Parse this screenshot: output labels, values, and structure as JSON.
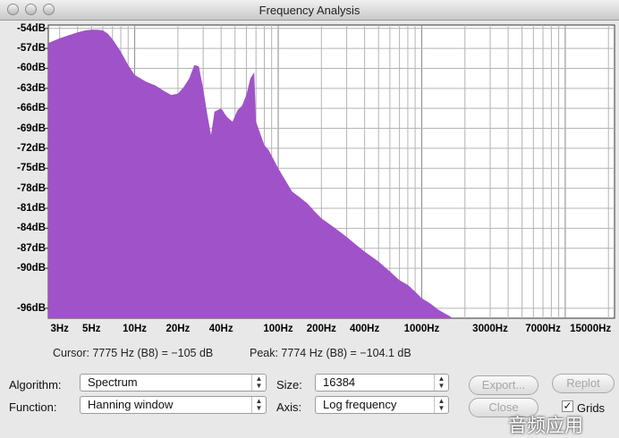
{
  "window": {
    "title": "Frequency Analysis"
  },
  "chart_data": {
    "type": "area",
    "title": "",
    "x_scale": "log",
    "x_unit": "Hz",
    "y_unit": "dB",
    "ylim": [
      -97.5,
      -53.5
    ],
    "xlim": [
      2.5,
      22050
    ],
    "grid": true,
    "fill_color": "#a052c8",
    "y_ticks": [
      -54,
      -57,
      -60,
      -63,
      -66,
      -69,
      -72,
      -75,
      -78,
      -81,
      -84,
      -87,
      -90,
      -96
    ],
    "y_tick_labels": [
      "-54dB",
      "-57dB",
      "-60dB",
      "-63dB",
      "-66dB",
      "-69dB",
      "-72dB",
      "-75dB",
      "-78dB",
      "-81dB",
      "-84dB",
      "-87dB",
      "-90dB",
      "-96dB"
    ],
    "x_tick_labels": [
      {
        "value": 3,
        "label": "3Hz"
      },
      {
        "value": 5,
        "label": "5Hz"
      },
      {
        "value": 10,
        "label": "10Hz"
      },
      {
        "value": 20,
        "label": "20Hz"
      },
      {
        "value": 40,
        "label": "40Hz"
      },
      {
        "value": 100,
        "label": "100Hz"
      },
      {
        "value": 200,
        "label": "200Hz"
      },
      {
        "value": 400,
        "label": "400Hz"
      },
      {
        "value": 1000,
        "label": "1000Hz"
      },
      {
        "value": 3000,
        "label": "3000Hz"
      },
      {
        "value": 7000,
        "label": "7000Hz"
      },
      {
        "value": 15000,
        "label": "15000Hz"
      }
    ],
    "series": [
      {
        "x": [
          2.5,
          3,
          3.5,
          4,
          4.5,
          5,
          5.5,
          6,
          6.5,
          7,
          8,
          9,
          10,
          12,
          14,
          16,
          18,
          20,
          22,
          24,
          26,
          28,
          30,
          32,
          34,
          36,
          40,
          44,
          48,
          52,
          56,
          60,
          64,
          68,
          70,
          75,
          80,
          86,
          92,
          100,
          110,
          125,
          140,
          160,
          180,
          200,
          250,
          300,
          350,
          400,
          500,
          600,
          700,
          800,
          900,
          1000,
          1150,
          1300,
          1450,
          1600
        ],
        "y": [
          -56.2,
          -55.5,
          -55,
          -54.6,
          -54.3,
          -54.2,
          -54.2,
          -54.3,
          -54.8,
          -55.6,
          -57.5,
          -59.5,
          -61,
          -62,
          -62.6,
          -63.4,
          -64,
          -63.8,
          -62.8,
          -61.5,
          -59.5,
          -59.7,
          -63,
          -66.8,
          -70,
          -66.5,
          -66,
          -67.3,
          -68,
          -66.3,
          -65.6,
          -64,
          -61.5,
          -60.6,
          -68,
          -69.8,
          -71.5,
          -72.3,
          -73.5,
          -75,
          -76.5,
          -78.5,
          -79.3,
          -80.3,
          -81.5,
          -82.5,
          -84,
          -85.3,
          -86.5,
          -87.5,
          -89,
          -90.5,
          -91.8,
          -92.5,
          -93.5,
          -94.5,
          -95.3,
          -96.2,
          -96.8,
          -97.3
        ]
      }
    ]
  },
  "status": {
    "cursor": "Cursor: 7775 Hz (B8) = −105 dB",
    "peak": "Peak: 7774 Hz (B8) = −104.1 dB"
  },
  "controls": {
    "algorithm_label": "Algorithm:",
    "algorithm_value": "Spectrum",
    "function_label": "Function:",
    "function_value": "Hanning window",
    "size_label": "Size:",
    "size_value": "16384",
    "axis_label": "Axis:",
    "axis_value": "Log frequency",
    "export_label": "Export...",
    "replot_label": "Replot",
    "close_label": "Close",
    "grids_label": "Grids",
    "grids_checked": true
  },
  "watermark": "音频应用"
}
